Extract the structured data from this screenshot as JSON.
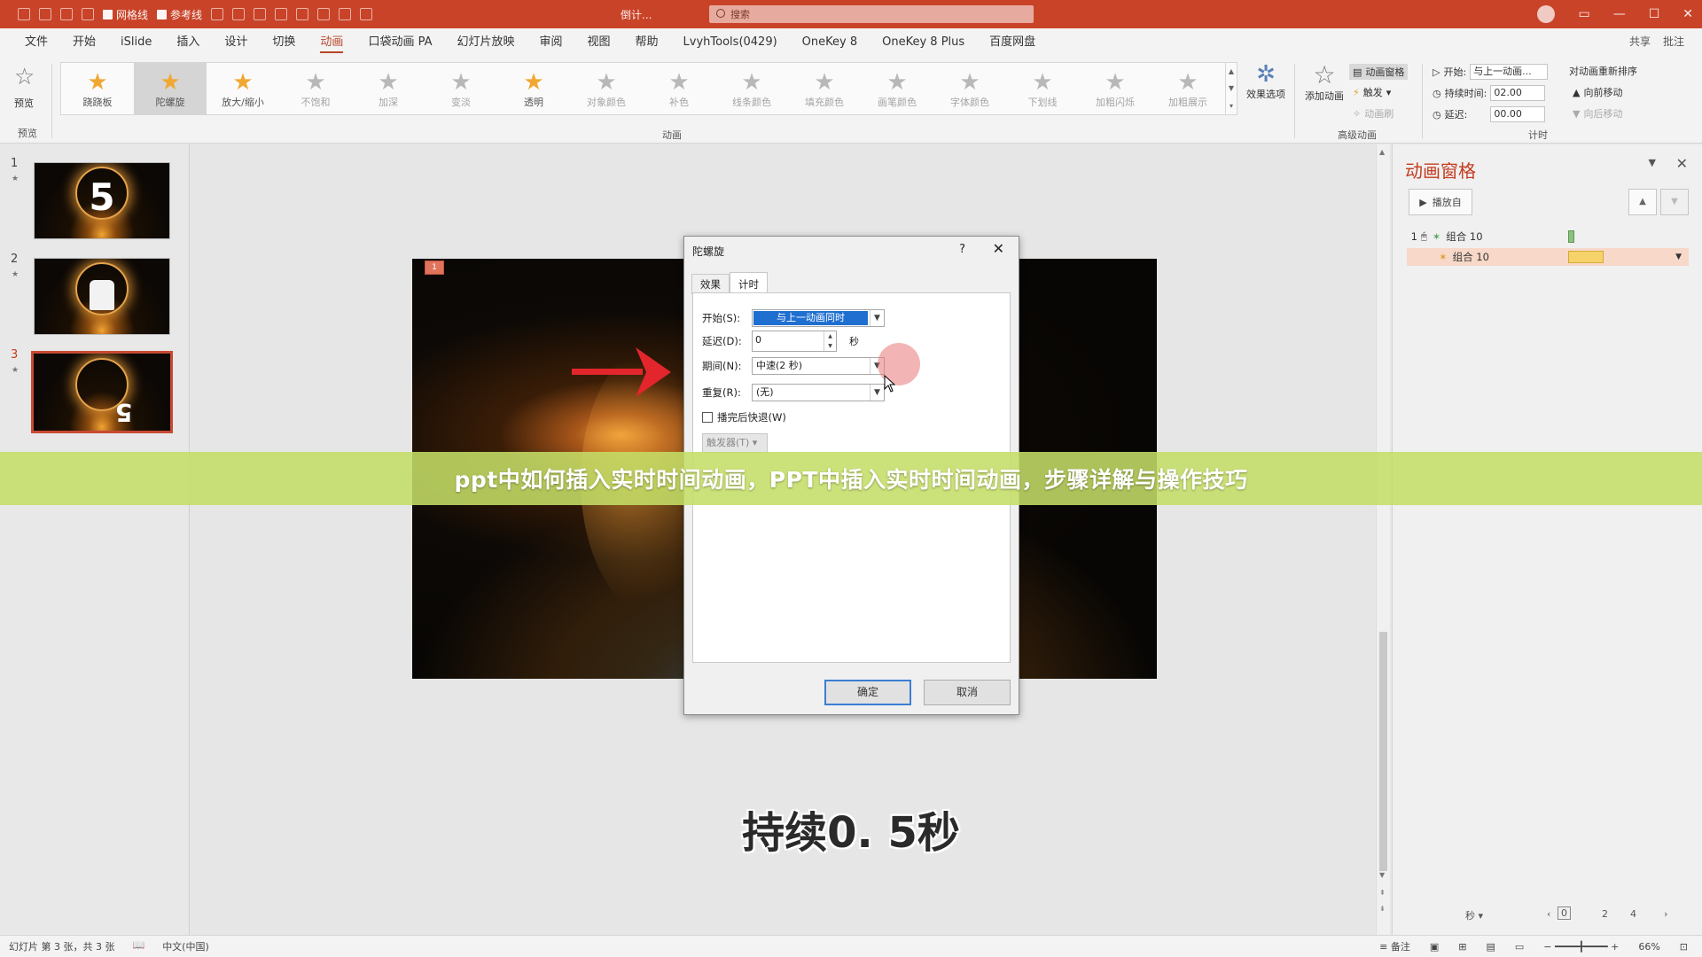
{
  "titlebar": {
    "gridlines_label": "网格线",
    "guides_label": "参考线",
    "doc_title": "倒计...",
    "search_placeholder": "搜索",
    "share_label": "共享",
    "comment_label": "批注"
  },
  "menu": {
    "tabs": [
      "文件",
      "开始",
      "iSlide",
      "插入",
      "设计",
      "切换",
      "动画",
      "口袋动画 PA",
      "幻灯片放映",
      "审阅",
      "视图",
      "帮助",
      "LvyhTools(0429)",
      "OneKey 8",
      "OneKey 8 Plus",
      "百度网盘"
    ],
    "active_index": 6
  },
  "ribbon": {
    "preview_label": "预览",
    "preview_group": "预览",
    "animation_group": "动画",
    "animations": [
      {
        "label": "跷跷板",
        "state": "gold"
      },
      {
        "label": "陀螺旋",
        "state": "selected"
      },
      {
        "label": "放大/缩小",
        "state": "gold"
      },
      {
        "label": "不饱和",
        "state": "gray"
      },
      {
        "label": "加深",
        "state": "gray"
      },
      {
        "label": "变淡",
        "state": "gray"
      },
      {
        "label": "透明",
        "state": "gold"
      },
      {
        "label": "对象颜色",
        "state": "gray"
      },
      {
        "label": "补色",
        "state": "gray"
      },
      {
        "label": "线条颜色",
        "state": "gray"
      },
      {
        "label": "填充颜色",
        "state": "gray"
      },
      {
        "label": "画笔颜色",
        "state": "gray"
      },
      {
        "label": "字体颜色",
        "state": "gray"
      },
      {
        "label": "下划线",
        "state": "gray"
      },
      {
        "label": "加粗闪烁",
        "state": "gray"
      },
      {
        "label": "加粗展示",
        "state": "gray"
      }
    ],
    "effect_options": "效果选项",
    "add_animation": "添加动画",
    "animation_pane": "动画窗格",
    "trigger": "触发",
    "animation_painter": "动画刷",
    "advanced_group": "高级动画",
    "start_label": "开始:",
    "start_value": "与上一动画...",
    "duration_label": "持续时间:",
    "duration_value": "02.00",
    "delay_label": "延迟:",
    "delay_value": "00.00",
    "reorder_label": "对动画重新排序",
    "move_earlier": "向前移动",
    "move_later": "向后移动",
    "timing_group": "计时"
  },
  "slides": [
    {
      "num": "1",
      "star": "★",
      "digit": "5"
    },
    {
      "num": "2",
      "star": "★",
      "digit": ""
    },
    {
      "num": "3",
      "star": "★",
      "digit": "5"
    }
  ],
  "slide_tag": "1",
  "dialog": {
    "title": "陀螺旋",
    "help": "?",
    "close": "✕",
    "tab_effect": "效果",
    "tab_timing": "计时",
    "start_label": "开始(S):",
    "start_value": "与上一动画同时",
    "delay_label": "延迟(D):",
    "delay_value": "0",
    "delay_unit": "秒",
    "period_label": "期间(N):",
    "period_value": "中速(2 秒)",
    "repeat_label": "重复(R):",
    "repeat_value": "(无)",
    "rewind_label": "播完后快退(W)",
    "trigger_label": "触发器(T)",
    "ok": "确定",
    "cancel": "取消"
  },
  "pane": {
    "title": "动画窗格",
    "play_label": "播放自",
    "items": [
      {
        "num": "1",
        "name": "组合 10"
      },
      {
        "num": "",
        "name": "组合 10"
      }
    ],
    "seconds_label": "秒",
    "ticks": [
      "0",
      "2",
      "4"
    ]
  },
  "status": {
    "slide_info": "幻灯片 第 3 张，共 3 张",
    "language": "中文(中国)",
    "notes": "备注",
    "zoom": "66%"
  },
  "overlay": {
    "banner": "ppt中如何插入实时时间动画，PPT中插入实时时间动画，步骤详解与操作技巧",
    "subtitle": "持续0. 5秒"
  },
  "colors": {
    "brand": "#c94328",
    "accent_text": "#c43b1f",
    "dialog_select": "#1f6fd1",
    "banner": "#c4dd67"
  }
}
